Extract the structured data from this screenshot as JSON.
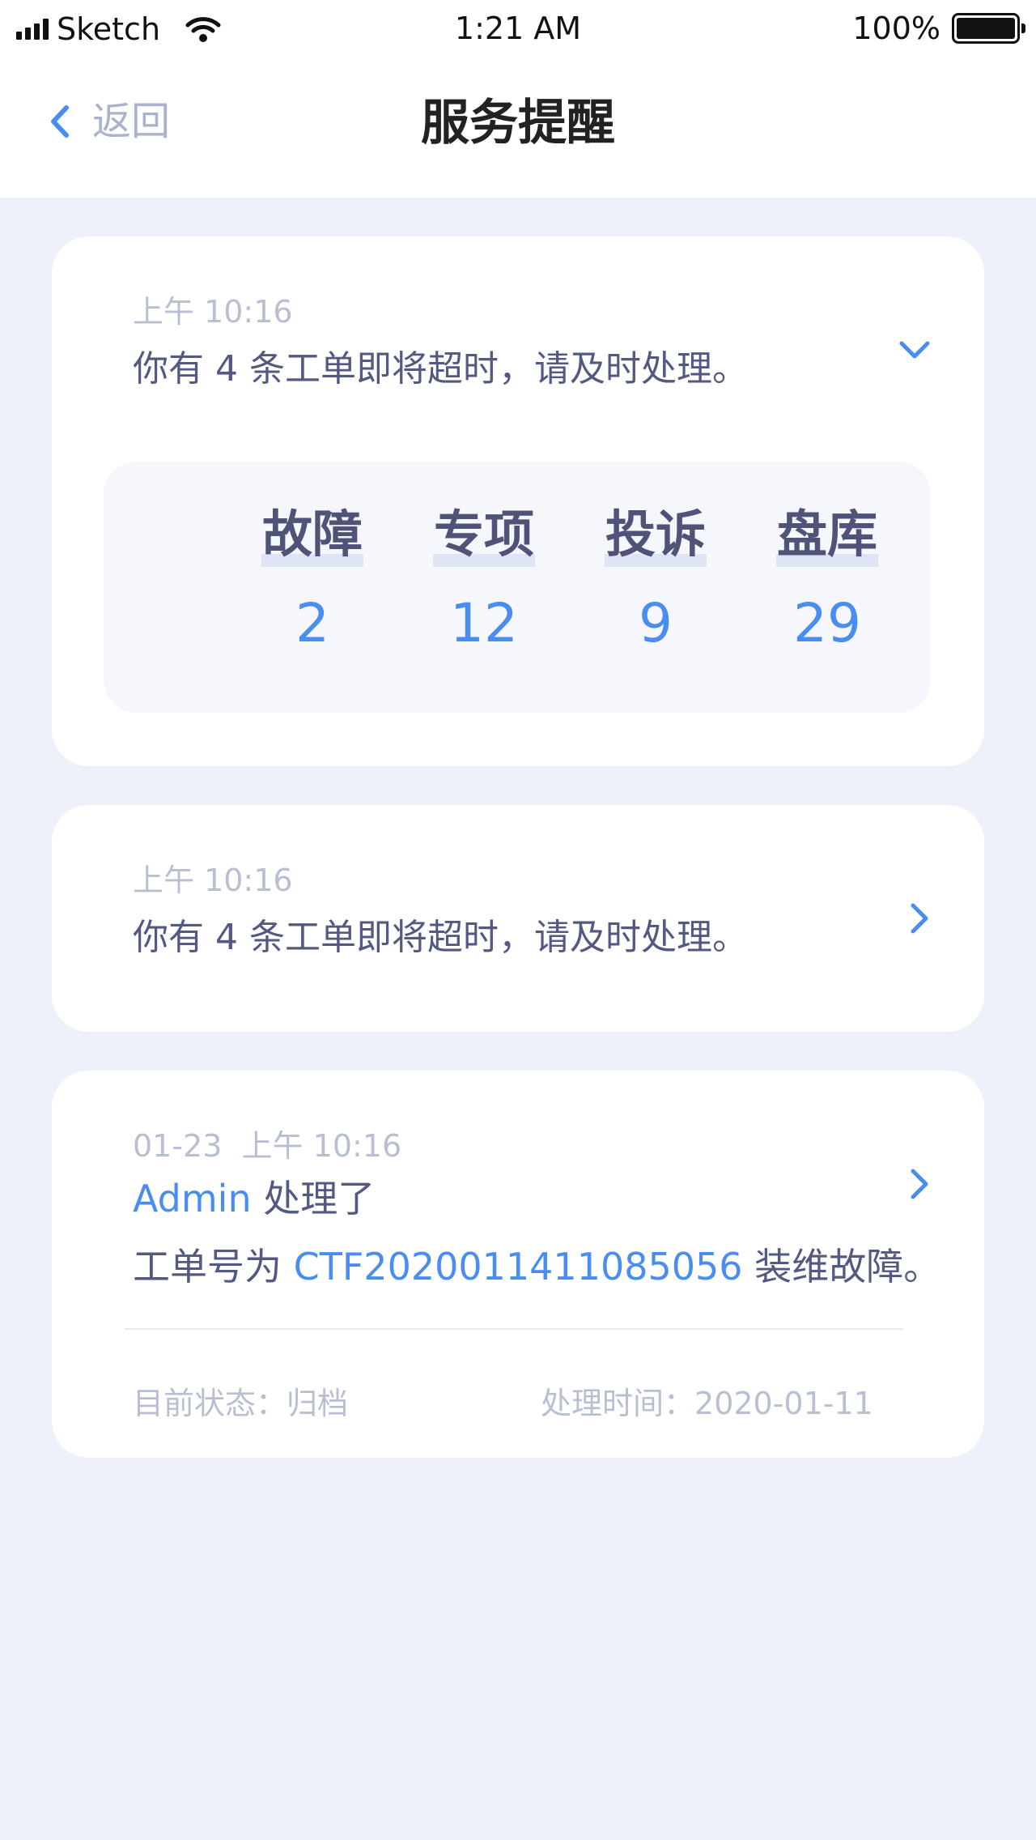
{
  "status_bar": {
    "carrier": "Sketch",
    "time": "1:21 AM",
    "battery": "100%"
  },
  "nav": {
    "back_label": "返回",
    "title": "服务提醒"
  },
  "cards": [
    {
      "time": "上午 10:16",
      "message": "你有 4 条工单即将超时，请及时处理。",
      "expanded": true,
      "stats": [
        {
          "label": "故障",
          "value": "2"
        },
        {
          "label": "专项",
          "value": "12"
        },
        {
          "label": "投诉",
          "value": "9"
        },
        {
          "label": "盘库",
          "value": "29"
        }
      ]
    },
    {
      "time": "上午 10:16",
      "message": "你有 4 条工单即将超时，请及时处理。",
      "expanded": false
    },
    {
      "date": "01-23",
      "time": "上午 10:16",
      "actor": "Admin",
      "action": " 处理了",
      "order_prefix": "工单号为 ",
      "order_number": "CTF2020011411085056",
      "order_suffix": " 装维故障。",
      "status_label": "目前状态：",
      "status_value": "归档",
      "processed_label": "处理时间：",
      "processed_value": "2020-01-11"
    }
  ],
  "colors": {
    "accent": "#4a8df0",
    "background": "#eef1f9",
    "text_primary": "#535980",
    "text_muted": "#b8bfd3"
  }
}
